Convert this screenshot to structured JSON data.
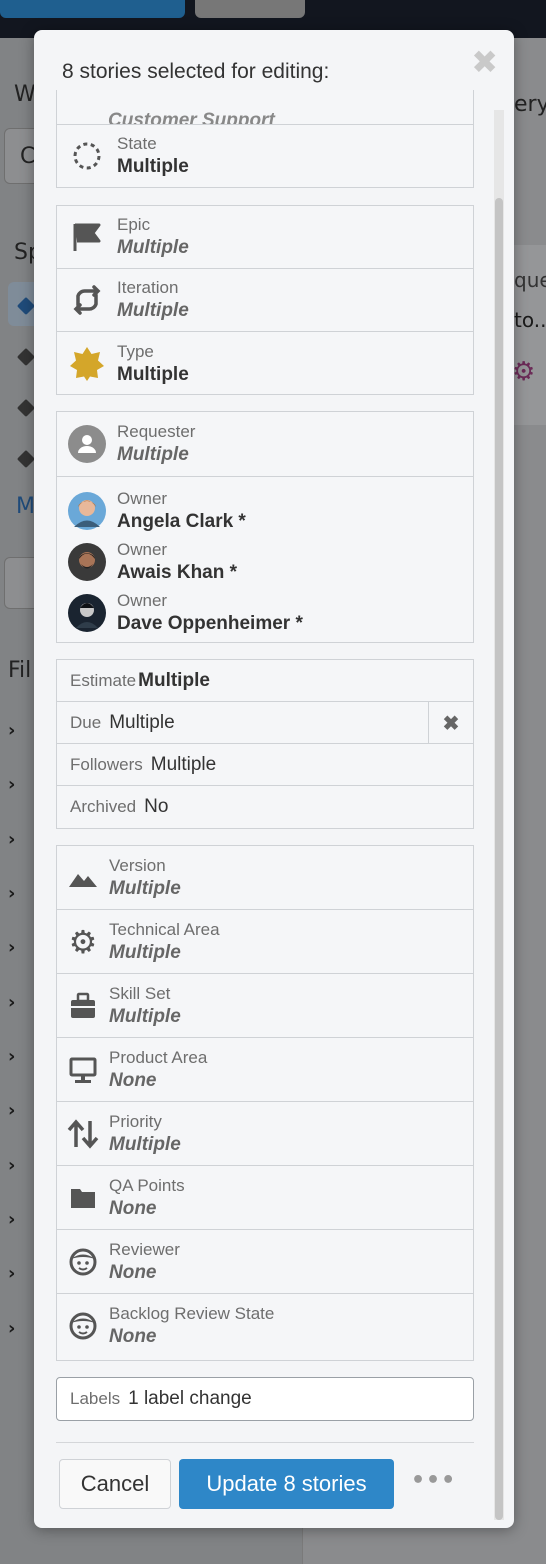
{
  "background": {
    "left_letters": [
      "W",
      "C",
      "Sp",
      "M",
      "Fil"
    ],
    "right_text": [
      "ery",
      "que",
      "to..."
    ]
  },
  "modal": {
    "title": "8 stories selected for editing:",
    "close_icon": "close-icon",
    "partial_top_value": "Customer Support",
    "groups": {
      "state": {
        "label": "State",
        "value": "Multiple"
      },
      "epic": {
        "label": "Epic",
        "value": "Multiple"
      },
      "iteration": {
        "label": "Iteration",
        "value": "Multiple"
      },
      "type": {
        "label": "Type",
        "value": "Multiple"
      },
      "requester": {
        "label": "Requester",
        "value": "Multiple"
      },
      "owners": [
        {
          "label": "Owner",
          "value": "Angela Clark *"
        },
        {
          "label": "Owner",
          "value": "Awais Khan *"
        },
        {
          "label": "Owner",
          "value": "Dave Oppenheimer *"
        }
      ],
      "estimate": {
        "label": "Estimate",
        "value": "Multiple"
      },
      "due": {
        "label": "Due",
        "value": "Multiple",
        "clear_icon": "clear-x-icon"
      },
      "followers": {
        "label": "Followers",
        "value": "Multiple"
      },
      "archived": {
        "label": "Archived",
        "value": "No"
      },
      "custom_fields": [
        {
          "label": "Version",
          "value": "Multiple",
          "icon": "mountain-icon"
        },
        {
          "label": "Technical Area",
          "value": "Multiple",
          "icon": "gear-icon"
        },
        {
          "label": "Skill Set",
          "value": "Multiple",
          "icon": "briefcase-icon"
        },
        {
          "label": "Product Area",
          "value": "None",
          "icon": "monitor-icon"
        },
        {
          "label": "Priority",
          "value": "Multiple",
          "icon": "sort-arrows-icon"
        },
        {
          "label": "QA Points",
          "value": "None",
          "icon": "folder-icon"
        },
        {
          "label": "Reviewer",
          "value": "None",
          "icon": "face-icon"
        },
        {
          "label": "Backlog Review State",
          "value": "None",
          "icon": "face-icon"
        }
      ],
      "labels": {
        "label": "Labels",
        "value": "1 label change"
      }
    },
    "buttons": {
      "cancel": "Cancel",
      "update": "Update 8 stories",
      "more": "•••"
    },
    "colors": {
      "primary": "#2e87c8",
      "type_star": "#d4a62a"
    }
  }
}
